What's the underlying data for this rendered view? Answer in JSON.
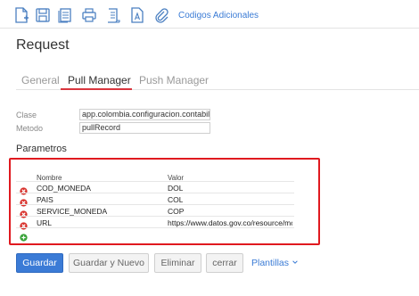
{
  "toolbar": {
    "icons": [
      "new-document-icon",
      "save-icon",
      "documents-icon",
      "print-icon",
      "scroll-icon",
      "text-file-icon",
      "attachment-icon"
    ],
    "extra_link": "Codigos Adicionales"
  },
  "page": {
    "title": "Request"
  },
  "tabs": [
    {
      "label": "General",
      "active": false
    },
    {
      "label": "Pull Manager",
      "active": true
    },
    {
      "label": "Push Manager",
      "active": false
    }
  ],
  "form": {
    "clase_label": "Clase",
    "clase_value": "app.colombia.configuracion.contabilidad",
    "metodo_label": "Metodo",
    "metodo_value": "pullRecord"
  },
  "params": {
    "title": "Parametros",
    "headers": {
      "name": "Nombre",
      "value": "Valor"
    },
    "rows": [
      {
        "name": "COD_MONEDA",
        "value": "DOL"
      },
      {
        "name": "PAIS",
        "value": "COL"
      },
      {
        "name": "SERVICE_MONEDA",
        "value": "COP"
      },
      {
        "name": "URL",
        "value": "https://www.datos.gov.co/resource/mcec"
      }
    ]
  },
  "buttons": {
    "save": "Guardar",
    "save_new": "Guardar y Nuevo",
    "delete": "Eliminar",
    "close": "cerrar",
    "templates": "Plantillas"
  },
  "colors": {
    "accent": "#3b7bd6",
    "highlight_border": "#e0191f",
    "tab_underline": "#d9363e"
  }
}
